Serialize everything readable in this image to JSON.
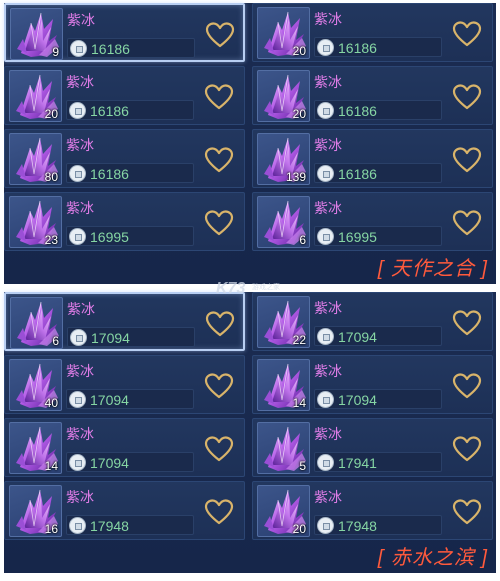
{
  "colors": {
    "name": "#e07de8",
    "price": "#86d6a4",
    "caption": "#ff5a3c",
    "panel_bg": "#1b2c52",
    "heart": "#d9b46a"
  },
  "item_icon": "purple-ice-crystal-icon",
  "currency_icon": "silver-coin-icon",
  "favorite_icon": "heart-outline-icon",
  "watermark": {
    "logo": "K73",
    "sub": "游戏之家"
  },
  "panels": [
    {
      "caption": "[ 天作之合 ]",
      "items": [
        {
          "name": "紫冰",
          "count": "9",
          "price": "16186",
          "selected": true
        },
        {
          "name": "紫冰",
          "count": "20",
          "price": "16186"
        },
        {
          "name": "紫冰",
          "count": "20",
          "price": "16186"
        },
        {
          "name": "紫冰",
          "count": "20",
          "price": "16186"
        },
        {
          "name": "紫冰",
          "count": "80",
          "price": "16186"
        },
        {
          "name": "紫冰",
          "count": "139",
          "price": "16186"
        },
        {
          "name": "紫冰",
          "count": "23",
          "price": "16995"
        },
        {
          "name": "紫冰",
          "count": "6",
          "price": "16995"
        }
      ]
    },
    {
      "caption": "[ 赤水之滨 ]",
      "items": [
        {
          "name": "紫冰",
          "count": "6",
          "price": "17094",
          "selected": true
        },
        {
          "name": "紫冰",
          "count": "22",
          "price": "17094"
        },
        {
          "name": "紫冰",
          "count": "40",
          "price": "17094"
        },
        {
          "name": "紫冰",
          "count": "14",
          "price": "17094"
        },
        {
          "name": "紫冰",
          "count": "14",
          "price": "17094"
        },
        {
          "name": "紫冰",
          "count": "5",
          "price": "17941"
        },
        {
          "name": "紫冰",
          "count": "16",
          "price": "17948"
        },
        {
          "name": "紫冰",
          "count": "20",
          "price": "17948"
        }
      ]
    }
  ]
}
